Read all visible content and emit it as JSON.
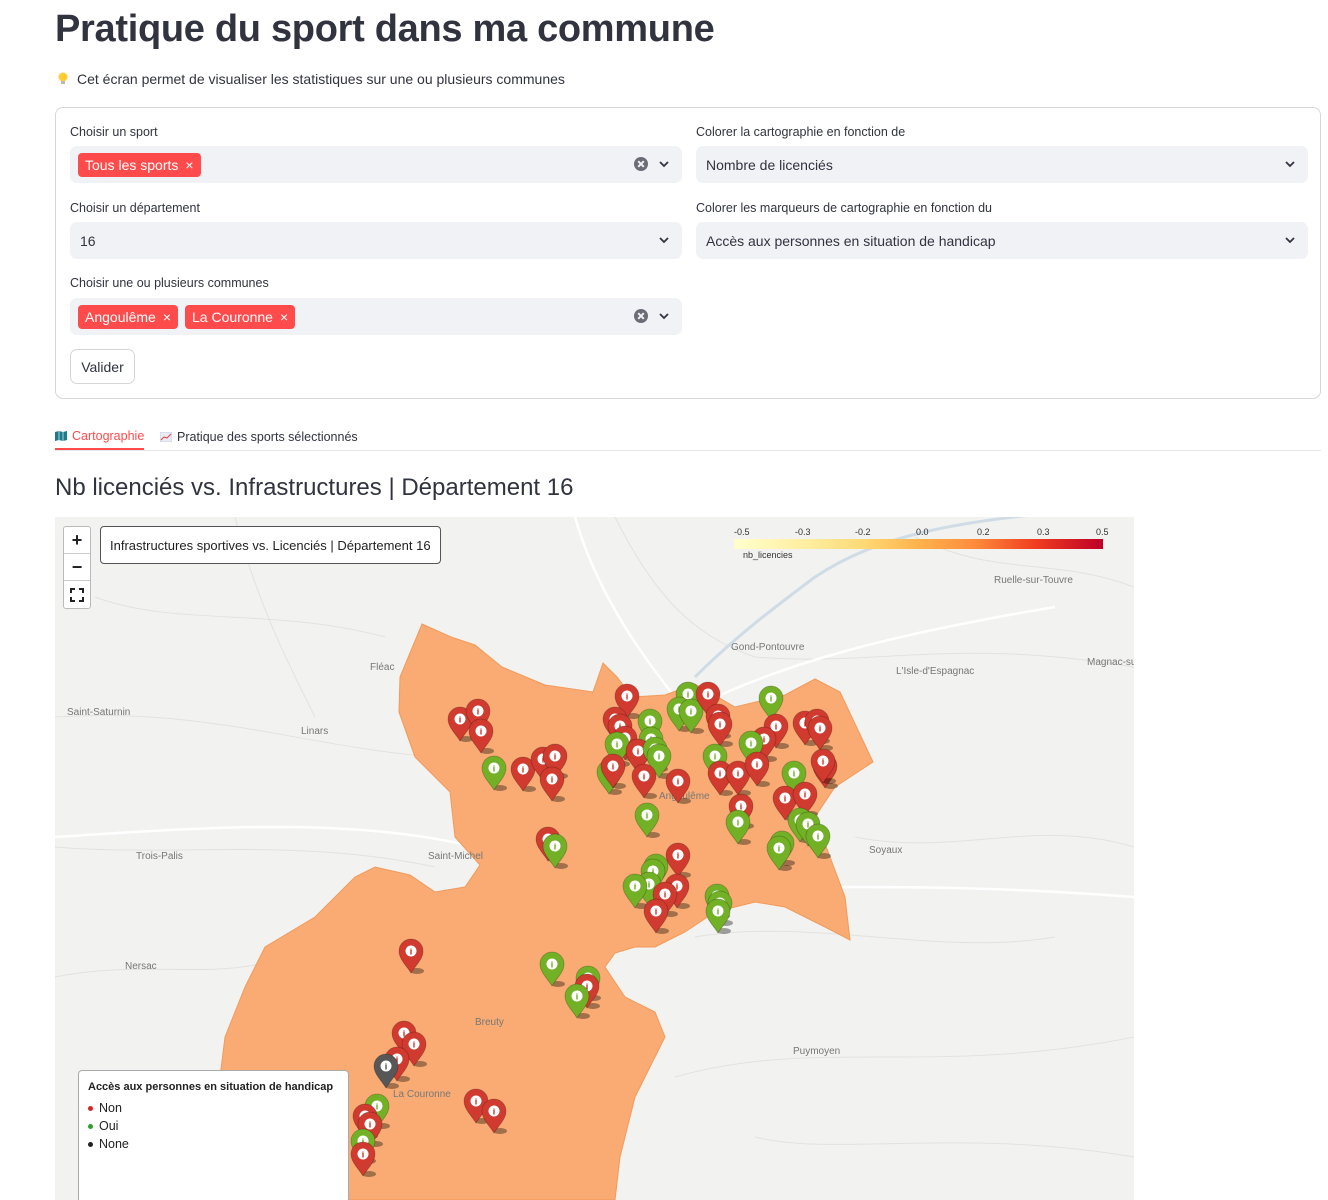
{
  "page": {
    "title": "Pratique du sport dans ma commune",
    "subtitle": "Cet écran permet de visualiser les statistiques sur une ou plusieurs communes"
  },
  "form": {
    "sport_label": "Choisir un sport",
    "sport_tags": [
      "Tous les sports"
    ],
    "color_map_label": "Colorer la cartographie en fonction de",
    "color_map_value": "Nombre de licenciés",
    "dept_label": "Choisir un département",
    "dept_value": "16",
    "marker_label": "Colorer les marqueurs de cartographie en fonction du",
    "marker_value": "Accès aux personnes en situation de handicap",
    "communes_label": "Choisir une ou plusieurs communes",
    "commune_tags": [
      "Angoulême",
      "La Couronne"
    ],
    "submit_label": "Valider"
  },
  "tabs": [
    {
      "label": "Cartographie",
      "icon": "map-icon",
      "active": true
    },
    {
      "label": "Pratique des sports sélectionnés",
      "icon": "chart-icon",
      "active": false
    }
  ],
  "section_title": "Nb licenciés vs. Infrastructures | Département 16",
  "map": {
    "title": "Infrastructures sportives vs. Licenciés | Département 16",
    "zoom_in": "+",
    "zoom_out": "−",
    "scale_ticks": [
      "-0.5",
      "-0.3",
      "-0.2",
      "0.0",
      "0.2",
      "0.3",
      "0.5"
    ],
    "scale_name": "nb_licencies",
    "legend_title": "Accès aux personnes en situation de handicap",
    "legend": [
      {
        "label": "Non",
        "color": "#d62728"
      },
      {
        "label": "Oui",
        "color": "#2ca02c"
      },
      {
        "label": "None",
        "color": "#222222"
      }
    ],
    "places": [
      "Ruelle-sur-Touvre",
      "Gond-Pontouvre",
      "L'Isle-d'Espagnac",
      "Magnac-sur-Touvre",
      "Fléac",
      "Saint-Saturnin",
      "Linars",
      "Angoulême",
      "Soyaux",
      "Trois-Palis",
      "Saint-Michel",
      "Nersac",
      "Breuty",
      "Puymoyen",
      "La Couronne"
    ],
    "colors": {
      "region": "#f9a66c",
      "red_marker": "#d13a2f",
      "green_marker": "#72b026",
      "gray_marker": "#575757"
    }
  },
  "colors": {
    "accent": "#ff4b4b",
    "text": "#31333f",
    "input_bg": "#f0f2f6"
  }
}
